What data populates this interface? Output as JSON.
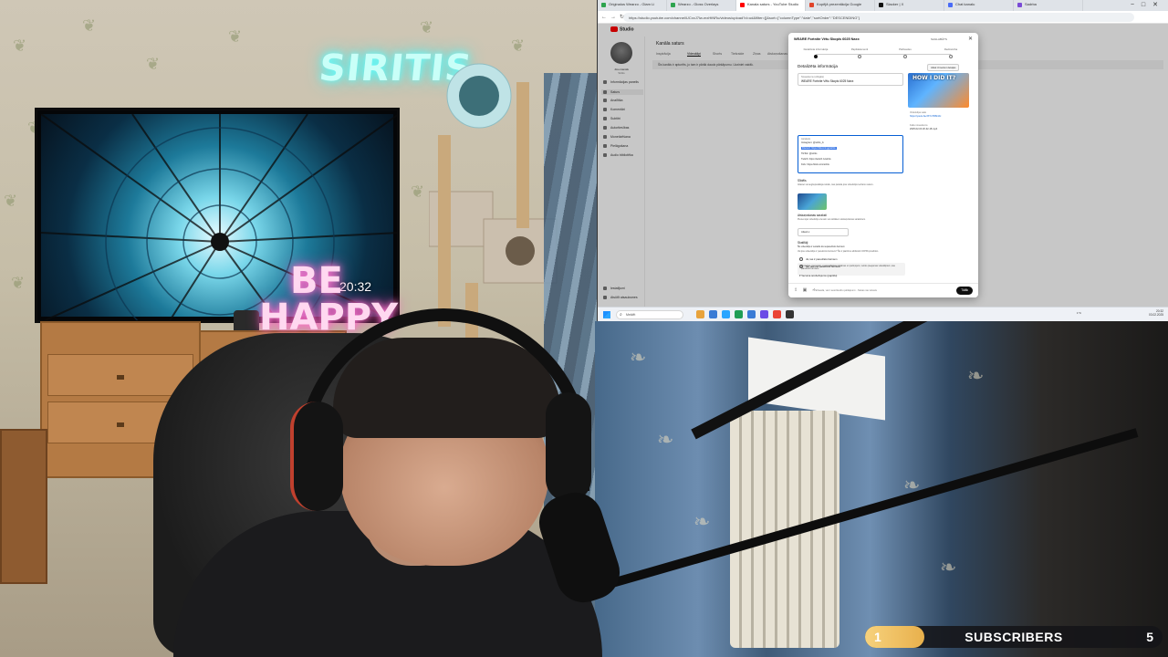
{
  "scene": {
    "neon_sign": "SIRITIS",
    "happy_sign_line1": "BE",
    "happy_sign_line2": "HAPPY",
    "tv_time": "20:32"
  },
  "browser": {
    "tabs": [
      {
        "label": "Originalus Wearzo - Glam Li",
        "color": "#2ea44f"
      },
      {
        "label": "Wearzo - Gloss Overlays",
        "color": "#2ea44f"
      },
      {
        "label": "Kanala saturs - YouTube Studio",
        "color": "#ff0000",
        "active": true
      },
      {
        "label": "Kopējā prezentācija Google",
        "color": "#e0442a"
      },
      {
        "label": "Slacker | X",
        "color": "#111111"
      },
      {
        "label": "Chat kanalu",
        "color": "#4a6cf7"
      },
      {
        "label": "Sadrba",
        "color": "#7a4bd6"
      }
    ],
    "url": "https://studio.youtube.com/channel/UCxxJ7lw-mxHtNRu/videos/upload?d=ud&filter=[]&sort={\"columnType\":\"date\",\"sortOrder\":\"DESCENDING\"}"
  },
  "yt": {
    "logo": "Studio",
    "channel_label": "Jūsu kanāls",
    "channel_name": "Siritis",
    "page_title": "Kanāla saturs",
    "main_tabs": [
      "Inspirācija",
      "Videoklipi",
      "Shorts",
      "Tiešraide",
      "Ziņas",
      "Atskaņošanas saraksti"
    ],
    "notice": "Šis kanāls ir apturēts, jo tam ir pārāk daudz pārkāpumu. Uzziniet vairāk.",
    "sidebar": [
      {
        "label": "Informācijas panelis"
      },
      {
        "label": "Saturs",
        "active": true
      },
      {
        "label": "Analītika"
      },
      {
        "label": "Komentāri"
      },
      {
        "label": "Subtitri"
      },
      {
        "label": "Autortiesības"
      },
      {
        "label": "Monetizēšana"
      },
      {
        "label": "Pielāgošana"
      },
      {
        "label": "Audio bibliotēka"
      },
      {
        "label": "Iestatījumi"
      },
      {
        "label": "Atsūtīt atsauksmes"
      }
    ]
  },
  "dialog": {
    "title": "WEARE Fortnite Vētu Skopis 6025 Naxx",
    "status": "SAGLABĀTS",
    "steps": [
      "Detalizēta informācija",
      "Papildelementi",
      "Pārbaudes",
      "Redzamība"
    ],
    "section_title": "Detalizēta informācija",
    "reuse_button": "Atkal izmantot detaļas",
    "title_field_label": "Nosaukums (obligāts)",
    "title_field_value": "WEARE Fortnite Vētu Skopis 6025 Naxx",
    "description_label": "Apraksts",
    "description_lines": [
      "Instagram: @siritis_lv",
      "Discord: https://discord.gg/siritis",
      "TikTok: @siritis",
      "Twitch: https://twitch.tv/siritis",
      "Kick: https://kick.com/siritis"
    ],
    "selected_line_index": 1,
    "thumb_overlay_text": "HOW I DID IT?",
    "video_link_label": "Videoklipa saite",
    "video_link_value": "https://youtu.be/JXYsTR8m0c",
    "filename_label": "Faila nosaukums",
    "filename_value": "2025-02-03 20-32-18.mp4",
    "thumbnail_head": "Sīktēls",
    "thumbnail_text": "Atlasiet vai augšupielādējiet attēlu, kas parāda jūsu videoklipā redzamo saturu.",
    "playlist_head": "Atskaņošanas saraksti",
    "playlist_text": "Pievienojiet videoklipu vienam vai vairākiem atskaņošanas sarakstiem.",
    "playlist_select": "Atlasīt",
    "audience_head": "Skatītāji",
    "audience_sub": "Šis videoklips ir iestatīts kā neparedzēts bērniem",
    "audience_text": "Vai jūsu videoklips ir paredzēts bērniem? Šis ir jāatzīmē atbilstoši COPPA prasībām.",
    "warn_text": "Funkcijas, piemēram, personalizētas reklāmas un paziņojumi, nebūs pieejamas videoklipiem, kas paredzēti bērniem.",
    "radio_yes": "Jā, tas ir paredzēts bērniem",
    "radio_no": "Nē, tas nav paredzēts bērniem",
    "age_restriction": "Vecuma ierobežojums (papildu)",
    "footer_text": "Pārbauda, vai ir autortiesību pārkāpumi... Nekas nav atrasts",
    "next_button": "Tālāk"
  },
  "taskbar": {
    "search_placeholder": "Meklēt",
    "weather": "1°C",
    "tray_time": "20:32",
    "tray_date": "03.02.2025",
    "app_colors": [
      "#e8a33c",
      "#3a7bd5",
      "#2aa5ff",
      "#1f9d55",
      "#3a7bd5",
      "#6b4ce6",
      "#ea4335",
      "#333333"
    ]
  },
  "overlay": {
    "sub_left": "1",
    "sub_label": "SUBSCRIBERS",
    "sub_right": "5",
    "sub_progress_fraction": 0.2
  }
}
